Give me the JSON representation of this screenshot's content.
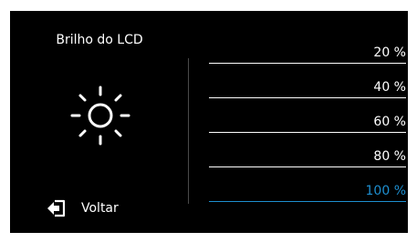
{
  "screen": {
    "title": "Brilho do LCD",
    "icon": "brightness-sun-icon"
  },
  "options": [
    {
      "label": "20 %",
      "selected": false
    },
    {
      "label": "40 %",
      "selected": false
    },
    {
      "label": "60 %",
      "selected": false
    },
    {
      "label": "80 %",
      "selected": false
    },
    {
      "label": "100 %",
      "selected": true
    }
  ],
  "back": {
    "label": "Voltar",
    "icon": "back-arrow-icon"
  },
  "colors": {
    "background": "#000000",
    "text": "#ffffff",
    "accent": "#1e8fd0"
  }
}
